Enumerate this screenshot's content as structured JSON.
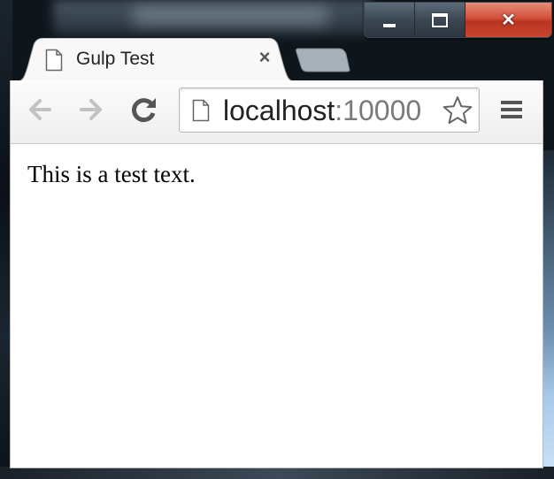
{
  "window": {
    "caption_buttons": [
      {
        "name": "minimize",
        "icon": "minimize-icon"
      },
      {
        "name": "maximize",
        "icon": "maximize-icon"
      },
      {
        "name": "close",
        "icon": "close-icon",
        "glyph": "✕"
      }
    ],
    "colors": {
      "close": "#c8472f",
      "caption": "#3b4753"
    }
  },
  "tabs": [
    {
      "title": "Gulp Test",
      "icon": "page-icon",
      "close_glyph": "×",
      "active": true
    }
  ],
  "toolbar": {
    "back_icon": "back-arrow-icon",
    "forward_icon": "forward-arrow-icon",
    "reload_icon": "reload-icon",
    "menu_icon": "hamburger-menu-icon"
  },
  "omnibox": {
    "host": "localhost",
    "port": ":10000",
    "page_icon": "page-icon",
    "bookmark_icon": "star-icon"
  },
  "page": {
    "text": "This is a test text."
  }
}
